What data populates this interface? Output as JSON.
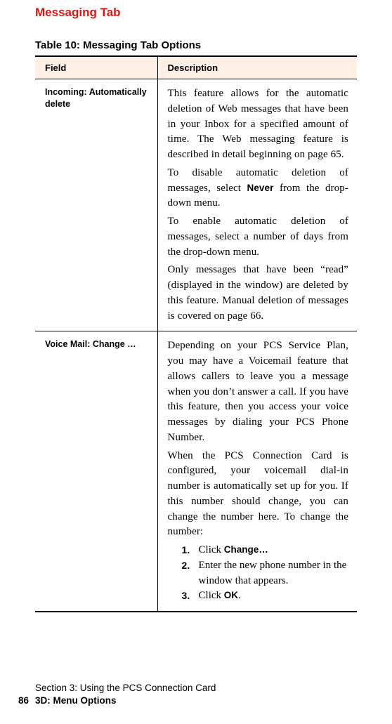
{
  "title": "Messaging Tab",
  "tableCaption": "Table 10: Messaging Tab Options",
  "headers": {
    "field": "Field",
    "description": "Description"
  },
  "rows": [
    {
      "field": "Incoming: Automatically delete",
      "desc": {
        "p1a": "This feature allows for the automatic deletion of Web messages that have been in your Inbox for a specified amount of time. The Web messaging feature is described in detail beginning on page 65.",
        "p2a": "To disable automatic deletion of messages, select ",
        "p2b": "Never",
        "p2c": " from the drop-down menu.",
        "p3": "To enable automatic deletion of messages, select a number of days from the drop-down menu.",
        "p4": "Only messages that have been “read” (displayed in the window) are deleted by this feature. Manual deletion of messages is covered on page 66."
      }
    },
    {
      "field": "Voice Mail: Change …",
      "desc": {
        "p1": "Depending on your PCS Service Plan, you may have a Voicemail feature that allows callers to leave you a message when you don’t answer a call. If you have this feature, then you access your voice messages by dialing your PCS Phone Number.",
        "p2": "When the PCS Connection Card is configured, your voicemail dial-in number is automatically set up for you. If this number should change, you can change the number here. To change the number:",
        "steps": {
          "s1a": "Click ",
          "s1b": "Change…",
          "s2": "Enter the new phone number in the window that appears.",
          "s3a": "Click ",
          "s3b": "OK",
          "s3c": "."
        }
      }
    }
  ],
  "footer": {
    "line1": "Section 3: Using the PCS Connection Card",
    "page": "86",
    "line2": "3D: Menu Options"
  }
}
